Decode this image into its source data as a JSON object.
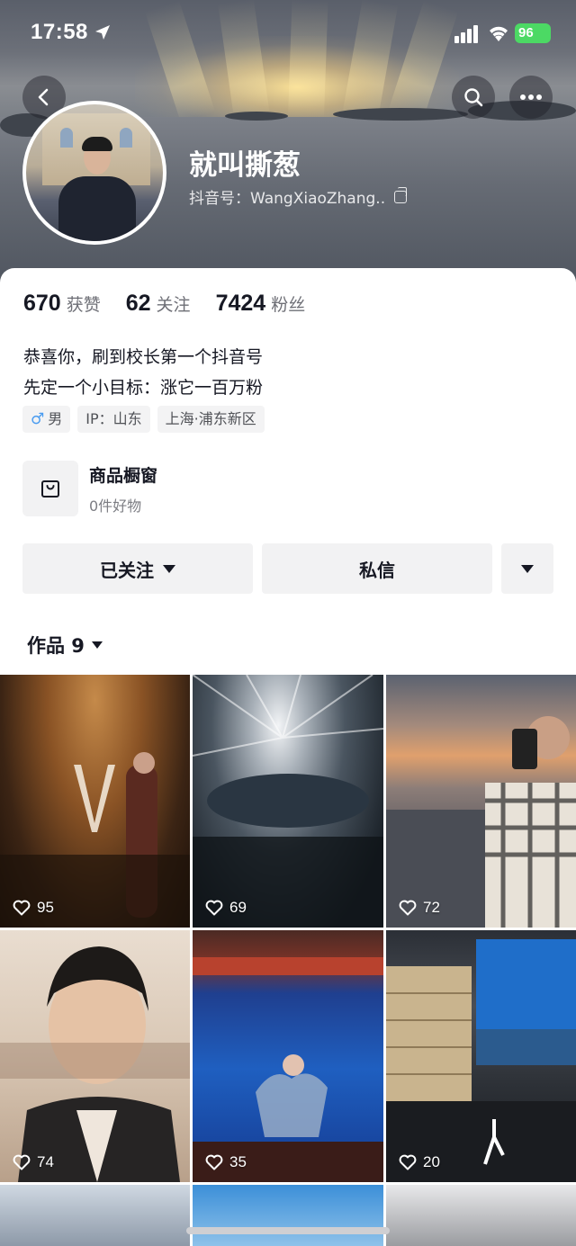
{
  "status_bar": {
    "time": "17:58",
    "battery": "96"
  },
  "profile": {
    "nickname": "就叫撕葱",
    "douyin_id": "抖音号：WangXiaoZhang..",
    "stats": [
      {
        "num": "670",
        "label": "获赞"
      },
      {
        "num": "62",
        "label": "关注"
      },
      {
        "num": "7424",
        "label": "粉丝"
      }
    ],
    "bio": [
      "恭喜你，刷到校长第一个抖音号",
      "先定一个小目标：涨它一百万粉"
    ],
    "tags": {
      "gender_symbol": "♂",
      "gender": "男",
      "ip": "IP：山东",
      "location": "上海·浦东新区"
    }
  },
  "shop": {
    "title": "商品橱窗",
    "subtitle": "0件好物"
  },
  "actions": {
    "followed": "已关注",
    "message": "私信"
  },
  "works_tab": {
    "label": "作品 9"
  },
  "works": [
    {
      "likes": "95"
    },
    {
      "likes": "69"
    },
    {
      "likes": "72"
    },
    {
      "likes": "74"
    },
    {
      "likes": "35"
    },
    {
      "likes": "20"
    }
  ],
  "colors": {
    "accent_battery": "#4cd964",
    "text_primary": "#161823",
    "text_secondary": "#6e6f76",
    "chip_bg": "#f3f3f4"
  }
}
